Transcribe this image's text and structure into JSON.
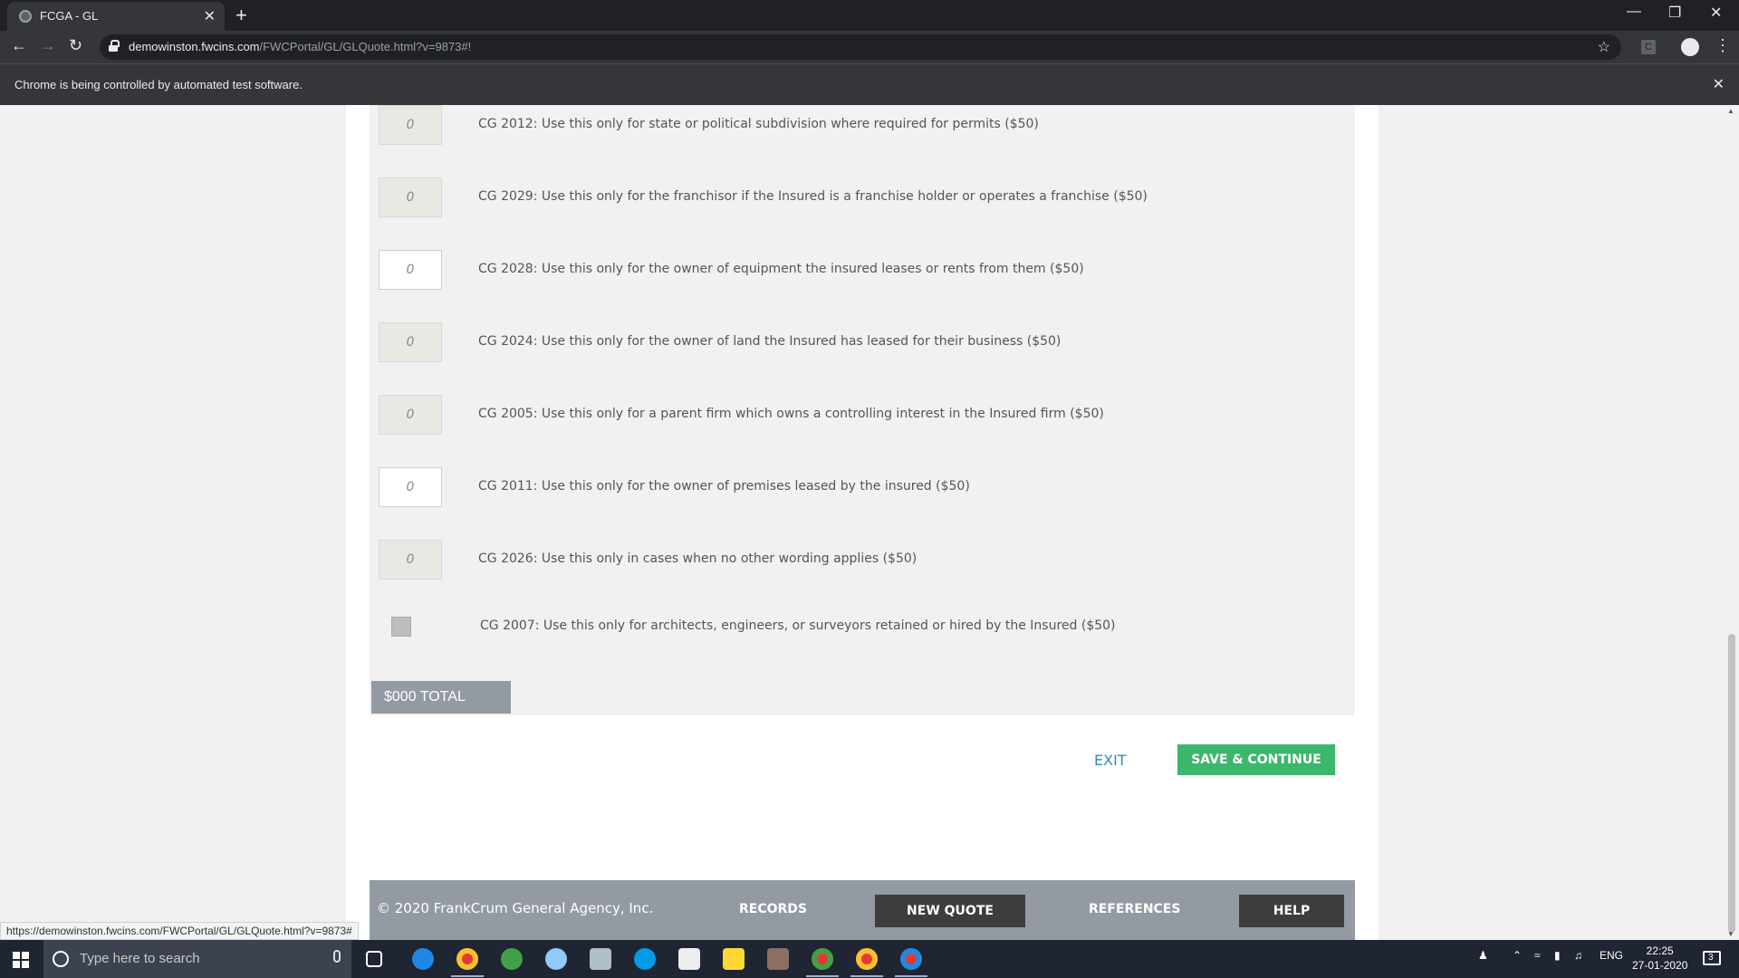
{
  "browser": {
    "tab_title": "FCGA - GL",
    "tab_close": "✕",
    "new_tab": "+",
    "url_host": "demowinston.fwcins.com",
    "url_path": "/FWCPortal/GL/GLQuote.html?v=9873#!",
    "extension_label": "C",
    "infobar_message": "Chrome is being controlled by automated test software.",
    "infobar_close": "✕",
    "status_url": "https://demowinston.fwcins.com/FWCPortal/GL/GLQuote.html?v=9873#"
  },
  "form": {
    "rows": [
      {
        "quantity": "0",
        "enabled": false,
        "label": "CG 2012: Use this only for state or political subdivision where required for permits ($50)"
      },
      {
        "quantity": "0",
        "enabled": false,
        "label": "CG 2029: Use this only for the franchisor if the Insured is a franchise holder or operates a franchise ($50)"
      },
      {
        "quantity": "0",
        "enabled": true,
        "label": "CG 2028: Use this only for the owner of equipment the insured leases or rents from them ($50)"
      },
      {
        "quantity": "0",
        "enabled": false,
        "label": "CG 2024: Use this only for the owner of land the Insured has leased for their business ($50)"
      },
      {
        "quantity": "0",
        "enabled": false,
        "label": "CG 2005: Use this only for a parent firm which owns a controlling interest in the Insured firm ($50)"
      },
      {
        "quantity": "0",
        "enabled": true,
        "label": "CG 2011: Use this only for the owner of premises leased by the insured ($50)"
      },
      {
        "quantity": "0",
        "enabled": false,
        "label": "CG 2026: Use this only in cases when no other wording applies ($50)"
      }
    ],
    "checkbox_row": {
      "checked": false,
      "label": "CG 2007: Use this only for architects, engineers, or surveyors retained or hired by the Insured ($50)"
    },
    "total_label": "$000 TOTAL",
    "exit_label": "EXIT",
    "save_label": "SAVE & CONTINUE"
  },
  "footer": {
    "copyright": "© 2020 FrankCrum General Agency, Inc.",
    "records": "RECORDS",
    "new_quote": "NEW QUOTE",
    "references": "REFERENCES",
    "help": "HELP"
  },
  "taskbar": {
    "search_placeholder": "Type here to search",
    "language": "ENG",
    "time": "22:25",
    "date": "27-01-2020",
    "notification_count": "3",
    "icons": [
      "task-view-icon",
      "edge-icon",
      "chrome-icon",
      "utorrent-icon",
      "steam-icon",
      "notepad-icon",
      "skype-icon",
      "photos-icon",
      "file-explorer-icon",
      "game-icon",
      "chrome-icon",
      "chrome-icon",
      "chrome-icon"
    ]
  },
  "colors": {
    "accent_green": "#3cb76b",
    "link_blue": "#2a8fbd",
    "footer_gray": "#939aa2"
  }
}
